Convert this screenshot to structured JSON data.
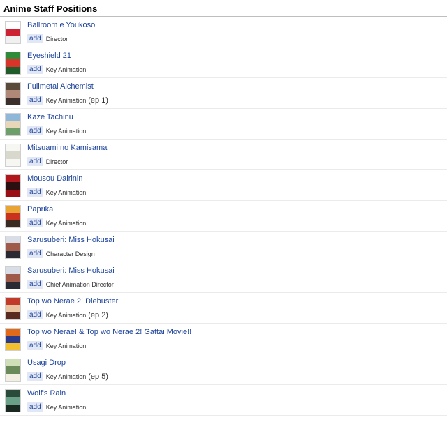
{
  "section": {
    "title": "Anime Staff Positions"
  },
  "add_label": "add",
  "rows": [
    {
      "title": "Ballroom e Youkoso",
      "position": "Director",
      "episode": "",
      "thumb_colors": [
        "#ffffff",
        "#cc2233",
        "#f0f0f0"
      ]
    },
    {
      "title": "Eyeshield 21",
      "position": "Key Animation",
      "episode": "",
      "thumb_colors": [
        "#2e8b3a",
        "#d8342a",
        "#1f5c2a"
      ]
    },
    {
      "title": "Fullmetal Alchemist",
      "position": "Key Animation",
      "episode": "(ep 1)",
      "thumb_colors": [
        "#5a4a3a",
        "#b08878",
        "#3a2f2a"
      ]
    },
    {
      "title": "Kaze Tachinu",
      "position": "Key Animation",
      "episode": "",
      "thumb_colors": [
        "#8fb7d9",
        "#e7d6b8",
        "#6e9f6a"
      ]
    },
    {
      "title": "Mitsuami no Kamisama",
      "position": "Director",
      "episode": "",
      "thumb_colors": [
        "#f6f6f2",
        "#d8d8cc",
        "#f6f6f2"
      ]
    },
    {
      "title": "Mousou Dairinin",
      "position": "Key Animation",
      "episode": "",
      "thumb_colors": [
        "#b0161b",
        "#2a1010",
        "#9a0f15"
      ]
    },
    {
      "title": "Paprika",
      "position": "Key Animation",
      "episode": "",
      "thumb_colors": [
        "#e8a534",
        "#c8321f",
        "#3a2a20"
      ]
    },
    {
      "title": "Sarusuberi: Miss Hokusai",
      "position": "Character Design",
      "episode": "",
      "thumb_colors": [
        "#d8dde6",
        "#a05a4a",
        "#2a2a34"
      ]
    },
    {
      "title": "Sarusuberi: Miss Hokusai",
      "position": "Chief Animation Director",
      "episode": "",
      "thumb_colors": [
        "#d8dde6",
        "#a05a4a",
        "#2a2a34"
      ]
    },
    {
      "title": "Top wo Nerae 2! Diebuster",
      "position": "Key Animation",
      "episode": "(ep 2)",
      "thumb_colors": [
        "#c23a2a",
        "#e8c4a0",
        "#5a2a20"
      ]
    },
    {
      "title": "Top wo Nerae! & Top wo Nerae 2! Gattai Movie!!",
      "position": "Key Animation",
      "episode": "",
      "thumb_colors": [
        "#e06a1a",
        "#2a3a8a",
        "#f0c030"
      ]
    },
    {
      "title": "Usagi Drop",
      "position": "Key Animation",
      "episode": "(ep 5)",
      "thumb_colors": [
        "#cfe0b8",
        "#6a8a5a",
        "#f2efe2"
      ]
    },
    {
      "title": "Wolf's Rain",
      "position": "Key Animation",
      "episode": "",
      "thumb_colors": [
        "#2a4a3a",
        "#6aa088",
        "#1a2a22"
      ]
    }
  ]
}
